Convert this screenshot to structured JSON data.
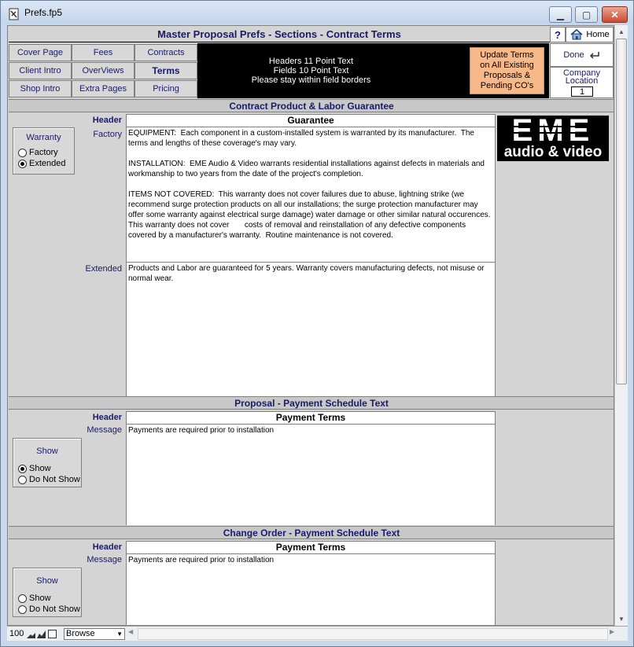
{
  "window": {
    "title": "Prefs.fp5"
  },
  "header": {
    "title": "Master Proposal Prefs - Sections - Contract Terms",
    "help_label": "?",
    "home_label": "Home"
  },
  "nav": {
    "row1": [
      "Cover Page",
      "Fees",
      "Contracts"
    ],
    "row2": [
      "Client Intro",
      "OverViews",
      "Terms"
    ],
    "row3": [
      "Shop Intro",
      "Extra Pages",
      "Pricing"
    ],
    "active": "Terms"
  },
  "info": {
    "line1": "Headers 11 Point Text",
    "line2": "Fields 10 Point Text",
    "line3": "Please stay within field borders"
  },
  "update_btn": {
    "line1": "Update Terms",
    "line2": "on All Existing",
    "line3": "Proposals &",
    "line4": "Pending CO's"
  },
  "done": {
    "label": "Done"
  },
  "company": {
    "label1": "Company",
    "label2": "Location",
    "value": "1"
  },
  "sections": {
    "guarantee": {
      "title": "Contract Product & Labor Guarantee",
      "header_label": "Header",
      "header_value": "Guarantee",
      "factory_label": "Factory",
      "factory_text": "EQUIPMENT:  Each component in a custom-installed system is warranted by its manufacturer.  The terms and lengths of these coverage's may vary.\n\nINSTALLATION:  EME Audio & Video warrants residential installations against defects in materials and workmanship to two years from the date of the project's completion.\n\nITEMS NOT COVERED:  This warranty does not cover failures due to abuse, lightning strike (we recommend surge protection products on all our installations; the surge protection manufacturer may offer some warranty against electrical surge damage) water damage or other similar natural occurences.  This warranty does not cover       costs of removal and reinstallation of any defective components covered by a manufacturer's warranty.  Routine maintenance is not covered.",
      "extended_label": "Extended",
      "extended_text": "Products and Labor are guaranteed for 5 years. Warranty covers manufacturing defects, not misuse or normal wear.",
      "radio_title": "Warranty",
      "radio_options": [
        "Factory",
        "Extended"
      ],
      "radio_selected": "Extended"
    },
    "proposal": {
      "title": "Proposal - Payment Schedule Text",
      "header_label": "Header",
      "header_value": "Payment Terms",
      "message_label": "Message",
      "message_text": "Payments are required prior to installation",
      "radio_title": "Show",
      "radio_options": [
        "Show",
        "Do Not Show"
      ],
      "radio_selected": "Show"
    },
    "change_order": {
      "title": "Change Order - Payment Schedule Text",
      "header_label": "Header",
      "header_value": "Payment Terms",
      "message_label": "Message",
      "message_text": "Payments are required prior to installation",
      "radio_title": "Show",
      "radio_options": [
        "Show",
        "Do Not Show"
      ],
      "radio_selected": "none"
    }
  },
  "logo": {
    "top": "EME",
    "bottom": "audio & video"
  },
  "status": {
    "zoom": "100",
    "mode": "Browse"
  }
}
